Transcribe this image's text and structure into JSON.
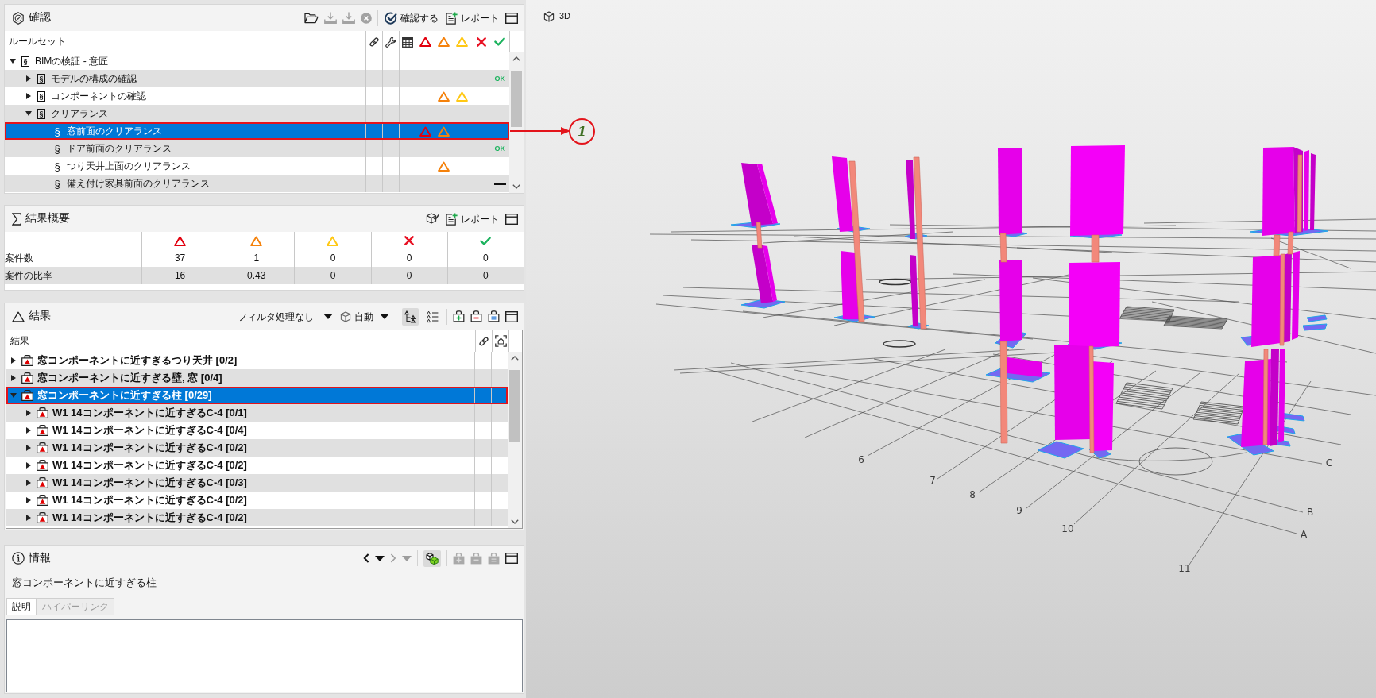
{
  "check_panel": {
    "title": "確認",
    "toolbar": [
      {
        "kind": "open",
        "disabled": false
      },
      {
        "kind": "download",
        "disabled": true
      },
      {
        "kind": "download",
        "disabled": true
      },
      {
        "kind": "stop",
        "disabled": true
      }
    ],
    "run_button": "確認する",
    "report_button": "レポート",
    "column_title": "ルールセット",
    "columns": [
      {
        "kind": "link"
      },
      {
        "kind": "wrench"
      },
      {
        "kind": "table"
      },
      {
        "kind": "critical"
      },
      {
        "kind": "major"
      },
      {
        "kind": "minor"
      },
      {
        "kind": "error"
      },
      {
        "kind": "passed"
      }
    ],
    "rulesets": [
      {
        "name": "BIMの検証 - 意匠",
        "kind": "ruleset",
        "symbol": "§",
        "expanded": true,
        "selected": false,
        "outlined": false,
        "critical": false,
        "major": false,
        "minor": false,
        "children": [
          {
            "name": "モデルの構成の確認",
            "kind": "ruleset",
            "symbol": "§",
            "expanded": false,
            "selected": false,
            "outlined": false,
            "critical": false,
            "major": false,
            "minor": false,
            "status": {
              "kind": "passed",
              "label": "OK"
            }
          },
          {
            "name": "コンポーネントの確認",
            "kind": "ruleset",
            "symbol": "§",
            "expanded": false,
            "selected": false,
            "outlined": false,
            "critical": false,
            "major": true,
            "minor": true
          },
          {
            "name": "クリアランス",
            "kind": "ruleset",
            "symbol": "§",
            "expanded": true,
            "selected": false,
            "outlined": false,
            "critical": false,
            "major": false,
            "minor": false,
            "children": [
              {
                "name": "窓前面のクリアランス",
                "kind": "rule",
                "symbol": "§",
                "selected": true,
                "outlined": true,
                "critical": true,
                "major": true,
                "minor": false
              },
              {
                "name": "ドア前面のクリアランス",
                "kind": "rule",
                "symbol": "§",
                "selected": false,
                "outlined": false,
                "critical": false,
                "major": false,
                "minor": false,
                "status": {
                  "kind": "passed",
                  "label": "OK"
                }
              },
              {
                "name": "つり天井上面のクリアランス",
                "kind": "rule",
                "symbol": "§",
                "selected": false,
                "outlined": false,
                "critical": false,
                "major": true,
                "minor": false
              },
              {
                "name": "備え付け家具前面のクリアランス",
                "kind": "rule",
                "symbol": "§",
                "selected": false,
                "outlined": false,
                "critical": false,
                "major": false,
                "minor": false,
                "status": {
                  "kind": "not_run"
                }
              }
            ]
          }
        ]
      }
    ]
  },
  "summary_panel": {
    "title": "結果概要",
    "report_button": "レポート",
    "columns": [
      {
        "kind": "critical"
      },
      {
        "kind": "major"
      },
      {
        "kind": "minor"
      },
      {
        "kind": "error"
      },
      {
        "kind": "passed"
      }
    ],
    "rows": [
      {
        "label": "案件数",
        "values": [
          "37",
          "1",
          "0",
          "0",
          "0"
        ]
      },
      {
        "label": "案件の比率",
        "values": [
          "16",
          "0.43",
          "0",
          "0",
          "0"
        ]
      }
    ]
  },
  "results_panel": {
    "title": "結果",
    "filter": "フィルタ処理なし",
    "mode": "自動",
    "view_buttons": [
      {
        "kind": "tree",
        "selected": true
      },
      {
        "kind": "list",
        "selected": false
      }
    ],
    "group_buttons": [
      {
        "kind": "add",
        "disabled": false
      },
      {
        "kind": "remove",
        "disabled": false
      },
      {
        "kind": "equal",
        "disabled": false
      }
    ],
    "column_title": "結果",
    "columns": [
      {
        "kind": "link"
      },
      {
        "kind": "viewpoint"
      }
    ],
    "results": [
      {
        "name": "窓コンポーネントに近すぎるつり天井 [0/2]",
        "expanded": false,
        "selected": false,
        "outlined": false
      },
      {
        "name": "窓コンポーネントに近すぎる壁, 窓 [0/4]",
        "expanded": false,
        "selected": false,
        "outlined": false
      },
      {
        "name": "窓コンポーネントに近すぎる柱 [0/29]",
        "expanded": true,
        "selected": true,
        "outlined": true,
        "children": [
          {
            "name": "W1 14コンポーネントに近すぎるC-4 [0/1]",
            "expanded": false,
            "selected": false,
            "outlined": false
          },
          {
            "name": "W1 14コンポーネントに近すぎるC-4 [0/4]",
            "expanded": false,
            "selected": false,
            "outlined": false
          },
          {
            "name": "W1 14コンポーネントに近すぎるC-4 [0/2]",
            "expanded": false,
            "selected": false,
            "outlined": false
          },
          {
            "name": "W1 14コンポーネントに近すぎるC-4 [0/2]",
            "expanded": false,
            "selected": false,
            "outlined": false
          },
          {
            "name": "W1 14コンポーネントに近すぎるC-4 [0/3]",
            "expanded": false,
            "selected": false,
            "outlined": false
          },
          {
            "name": "W1 14コンポーネントに近すぎるC-4 [0/2]",
            "expanded": false,
            "selected": false,
            "outlined": false
          },
          {
            "name": "W1 14コンポーネントに近すぎるC-4 [0/2]",
            "expanded": false,
            "selected": false,
            "outlined": false
          }
        ]
      }
    ]
  },
  "info_panel": {
    "title": "情報",
    "navigation": [
      {
        "kind": "back",
        "disabled": false
      },
      {
        "kind": "forward",
        "disabled": true
      }
    ],
    "highlight_button": {
      "selected": true
    },
    "group_buttons": [
      {
        "kind": "add",
        "disabled": true
      },
      {
        "kind": "remove",
        "disabled": true
      },
      {
        "kind": "equal",
        "disabled": true
      }
    ],
    "heading": "窓コンポーネントに近すぎる柱",
    "tabs": [
      {
        "label": "説明",
        "selected": true
      },
      {
        "label": "ハイパーリンク",
        "selected": false
      }
    ]
  },
  "viewport": {
    "title": "3D",
    "grid_labels": [
      "6",
      "7",
      "8",
      "9",
      "10",
      "11",
      "A",
      "B",
      "C"
    ]
  },
  "callout": {
    "label": "1"
  }
}
